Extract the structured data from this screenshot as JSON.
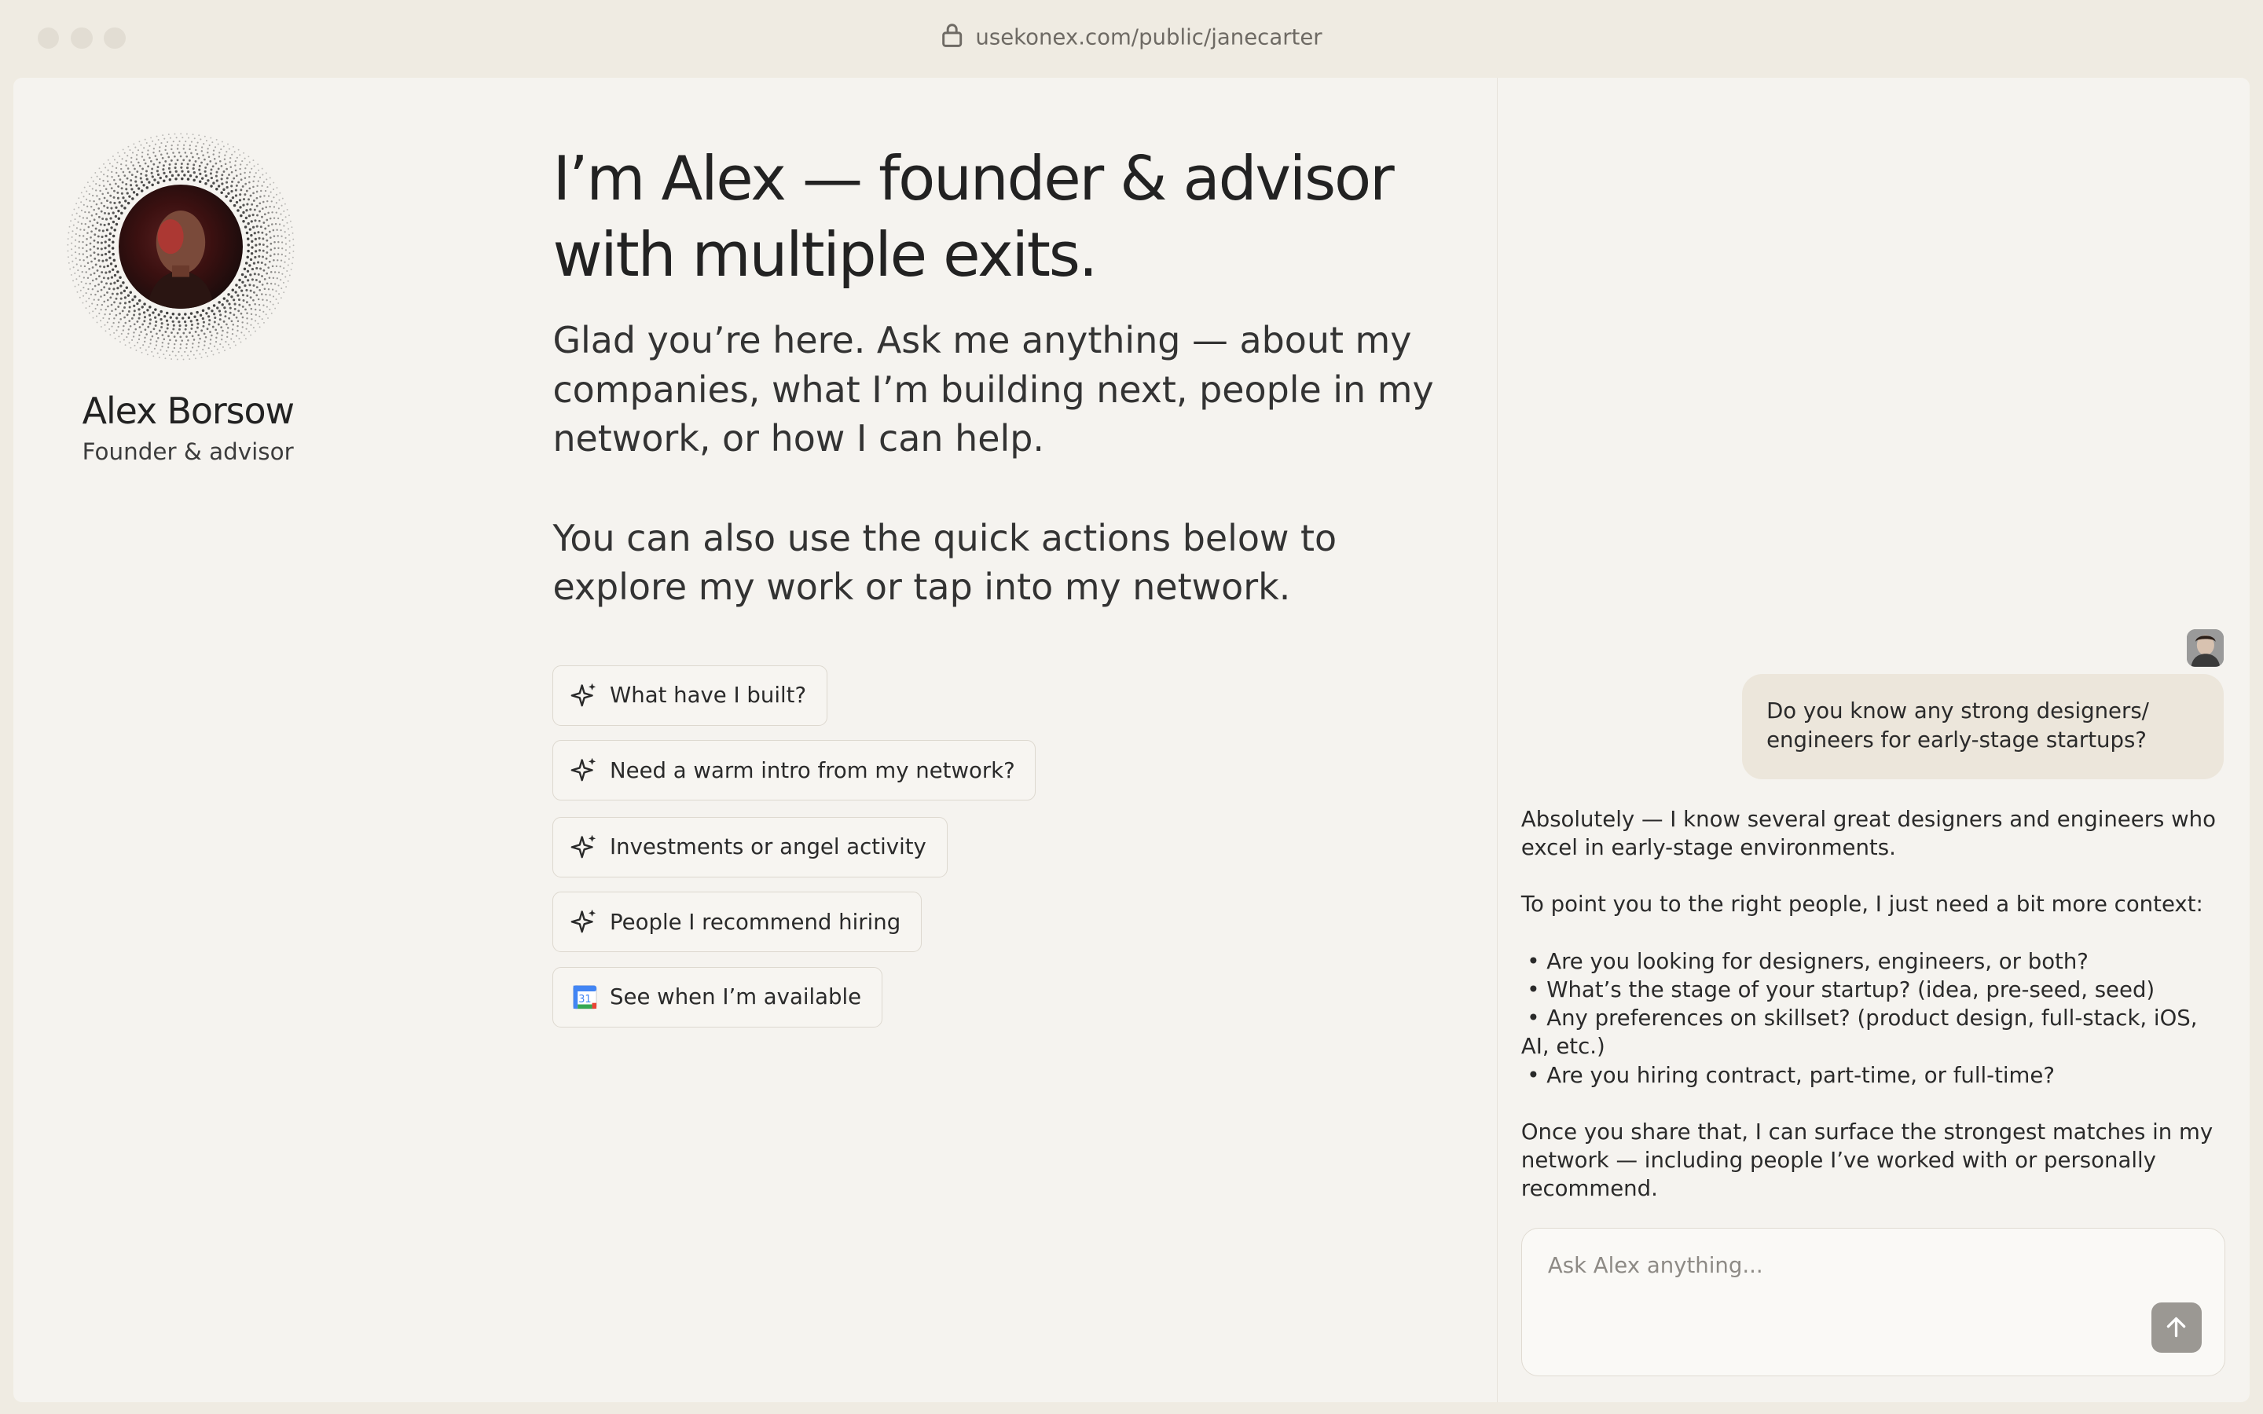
{
  "browser": {
    "url": "usekonex.com/public/janecarter"
  },
  "profile": {
    "name": "Alex Borsow",
    "role": "Founder & advisor"
  },
  "main": {
    "headline": "I’m Alex — founder & advisor with multiple exits.",
    "intro": "Glad you’re here. Ask me anything — about my companies, what I’m building next, people in my network, or how I can help.",
    "intro2": "You can also use the quick actions below to explore my work or tap into my network.",
    "quick_actions": [
      {
        "label": "What have I built?",
        "icon": "sparkle-icon"
      },
      {
        "label": "Need a warm intro from my network?",
        "icon": "sparkle-icon"
      },
      {
        "label": "Investments or angel activity",
        "icon": "sparkle-icon"
      },
      {
        "label": "People I recommend hiring",
        "icon": "sparkle-icon"
      },
      {
        "label": "See when I’m available",
        "icon": "calendar-icon"
      }
    ]
  },
  "chat": {
    "user_message": "Do you know any strong designers/ engineers for early-stage startups?",
    "reply_p1": "Absolutely — I know several great designers and engineers who excel in early-stage environments.",
    "reply_p2": "To point you to the right people, I just need a bit more context:",
    "reply_bullets": [
      "Are you looking for designers, engineers, or both?",
      "What’s the stage of your startup? (idea, pre-seed, seed)",
      "Any preferences on skillset? (product design, full-stack, iOS, AI, etc.)",
      "Are you hiring contract, part-time, or full-time?"
    ],
    "reply_p3": "Once you share that, I can surface the strongest matches in my network — including people I’ve worked with or personally recommend.",
    "input_placeholder": "Ask Alex anything...",
    "calendar_icon_text": "31"
  },
  "colors": {
    "page_bg": "#efebe2",
    "panel_bg": "#f5f3ef",
    "bubble_bg": "#ece6db",
    "send_button": "#9b9893"
  }
}
